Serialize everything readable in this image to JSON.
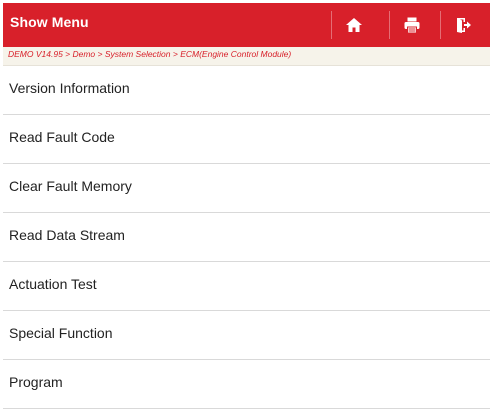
{
  "header": {
    "title": "Show Menu",
    "accent_color": "#d8202a",
    "icons": [
      "home-icon",
      "print-icon",
      "exit-icon"
    ]
  },
  "breadcrumb": "DEMO V14.95 > Demo > System Selection > ECM(Engine Control Module)",
  "menu": {
    "items": [
      {
        "label": "Version Information"
      },
      {
        "label": "Read Fault Code"
      },
      {
        "label": "Clear Fault Memory"
      },
      {
        "label": "Read Data Stream"
      },
      {
        "label": "Actuation Test"
      },
      {
        "label": "Special Function"
      },
      {
        "label": "Program"
      }
    ]
  }
}
